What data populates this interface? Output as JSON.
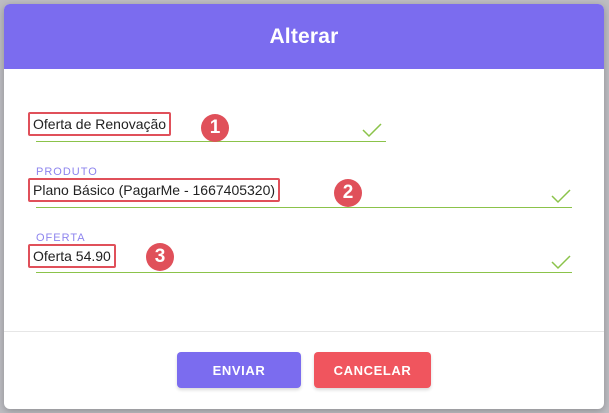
{
  "dialog": {
    "title": "Alterar"
  },
  "fields": [
    {
      "label": "",
      "value": "Oferta de Renovação",
      "marker": "1"
    },
    {
      "label": "PRODUTO",
      "value": "Plano Básico (PagarMe - 1667405320)",
      "marker": "2"
    },
    {
      "label": "OFERTA",
      "value": "Oferta 54.90",
      "marker": "3"
    }
  ],
  "buttons": {
    "submit": "ENVIAR",
    "cancel": "CANCELAR"
  },
  "colors": {
    "accent": "#7b6cef",
    "danger": "#f0555e",
    "valid": "#8bc34a",
    "highlight": "#e0505a"
  },
  "icons": {
    "valid": "check-icon"
  }
}
